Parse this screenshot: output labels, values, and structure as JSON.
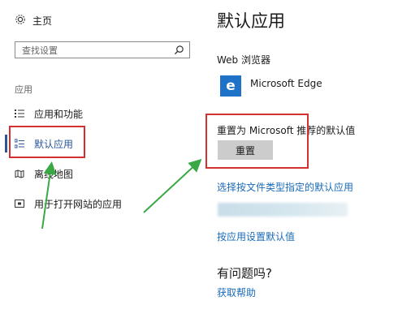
{
  "sidebar": {
    "home_label": "主页",
    "search_placeholder": "查找设置",
    "section_label": "应用",
    "items": [
      {
        "label": "应用和功能",
        "icon": "list-icon"
      },
      {
        "label": "默认应用",
        "icon": "default-apps-icon",
        "active": true
      },
      {
        "label": "离线地图",
        "icon": "map-icon"
      },
      {
        "label": "用于打开网站的应用",
        "icon": "web-open-icon"
      }
    ]
  },
  "main": {
    "title": "默认应用",
    "web_browser_label": "Web 浏览器",
    "browser_name": "Microsoft Edge",
    "browser_icon_glyph": "e",
    "reset_text": "重置为 Microsoft 推荐的默认值",
    "reset_button": "重置",
    "link_by_file_type": "选择按文件类型指定的默认应用",
    "link_by_app": "按应用设置默认值",
    "help_title": "有问题吗?",
    "help_link": "获取帮助"
  },
  "colors": {
    "accent": "#2b5797",
    "link": "#1a6bb8",
    "edge_tile": "#1e73c8",
    "highlight_box": "#d33131",
    "arrow": "#3aa845"
  }
}
